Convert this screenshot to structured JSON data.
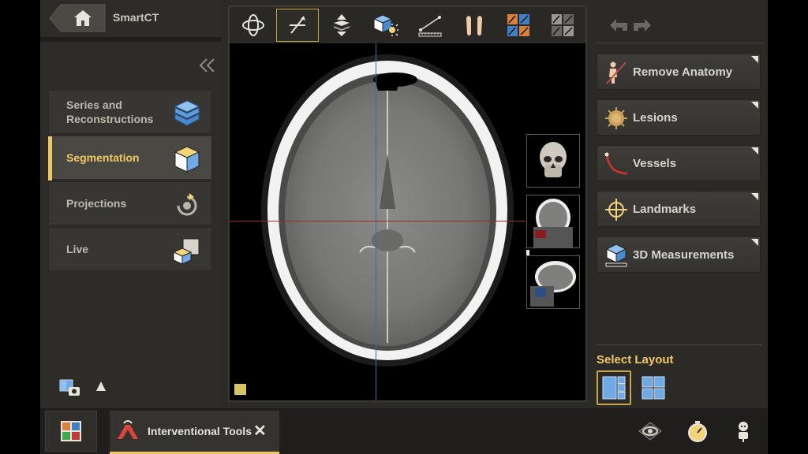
{
  "app": {
    "name": "SmartCT"
  },
  "nav": {
    "items": [
      {
        "label": "Series and Reconstructions",
        "icon": "stack-cube-icon",
        "active": false
      },
      {
        "label": "Segmentation",
        "icon": "cube-icon",
        "active": true
      },
      {
        "label": "Projections",
        "icon": "rotate-icon",
        "active": false
      },
      {
        "label": "Live",
        "icon": "live-cube-icon",
        "active": false
      }
    ]
  },
  "toolbar": {
    "tools": [
      {
        "name": "rotate-tool-icon",
        "active": false
      },
      {
        "name": "window-level-tool-icon",
        "active": true
      },
      {
        "name": "slab-tool-icon",
        "active": false
      },
      {
        "name": "volume-light-tool-icon",
        "active": false
      },
      {
        "name": "ruler-tool-icon",
        "active": false
      },
      {
        "name": "feet-orientation-icon",
        "active": false
      },
      {
        "name": "color-map-icon",
        "active": false
      },
      {
        "name": "gray-map-icon",
        "active": false
      }
    ]
  },
  "right_panel": {
    "buttons": [
      {
        "label": "Remove Anatomy",
        "icon": "remove-anatomy-icon"
      },
      {
        "label": "Lesions",
        "icon": "lesion-icon"
      },
      {
        "label": "Vessels",
        "icon": "vessel-icon"
      },
      {
        "label": "Landmarks",
        "icon": "landmark-crosshair-icon"
      },
      {
        "label": "3D Measurements",
        "icon": "measurement-cube-icon"
      }
    ],
    "layout_title": "Select Layout"
  },
  "bottom": {
    "tab_label": "Interventional Tools",
    "close_glyph": "✕"
  },
  "colors": {
    "accent": "#f0c764",
    "active_border": "#c9a548",
    "crosshair_blue": "#3a6ea8",
    "crosshair_red": "#a02a2a"
  }
}
